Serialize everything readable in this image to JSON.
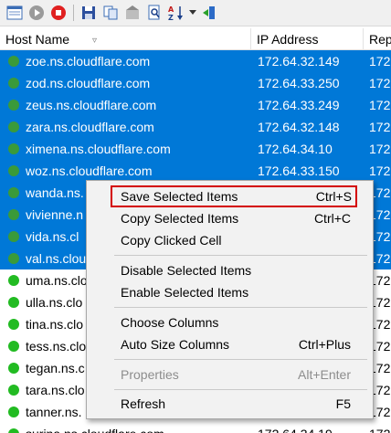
{
  "columns": {
    "host": "Host Name",
    "ip": "IP Address",
    "rep": "Rep"
  },
  "rows": [
    {
      "host": "zoe.ns.cloudflare.com",
      "ip": "172.64.32.149",
      "rep": "172"
    },
    {
      "host": "zod.ns.cloudflare.com",
      "ip": "172.64.33.250",
      "rep": "172"
    },
    {
      "host": "zeus.ns.cloudflare.com",
      "ip": "172.64.33.249",
      "rep": "172"
    },
    {
      "host": "zara.ns.cloudflare.com",
      "ip": "172.64.32.148",
      "rep": "172"
    },
    {
      "host": "ximena.ns.cloudflare.com",
      "ip": "172.64.34.10",
      "rep": "172"
    },
    {
      "host": "woz.ns.cloudflare.com",
      "ip": "172.64.33.150",
      "rep": "172"
    },
    {
      "host": "wanda.ns.",
      "ip": "",
      "rep": "172"
    },
    {
      "host": "vivienne.n",
      "ip": "",
      "rep": "172"
    },
    {
      "host": "vida.ns.cl",
      "ip": "",
      "rep": "172"
    },
    {
      "host": "val.ns.clou",
      "ip": "",
      "rep": "172"
    },
    {
      "host": "uma.ns.clo",
      "ip": "",
      "rep": "172"
    },
    {
      "host": "ulla.ns.clo",
      "ip": "",
      "rep": "172"
    },
    {
      "host": "tina.ns.clo",
      "ip": "",
      "rep": "172"
    },
    {
      "host": "tess.ns.clo",
      "ip": "",
      "rep": "172"
    },
    {
      "host": "tegan.ns.c",
      "ip": "",
      "rep": "172"
    },
    {
      "host": "tara.ns.clo",
      "ip": "",
      "rep": "172"
    },
    {
      "host": "tanner.ns.",
      "ip": "",
      "rep": "172"
    },
    {
      "host": "surina.ns.cloudflare.com",
      "ip": "172.64.34.19",
      "rep": "172"
    }
  ],
  "menu": {
    "save": {
      "label": "Save Selected Items",
      "shortcut": "Ctrl+S"
    },
    "copy_selected": {
      "label": "Copy Selected Items",
      "shortcut": "Ctrl+C"
    },
    "copy_cell": {
      "label": "Copy Clicked Cell",
      "shortcut": ""
    },
    "disable": {
      "label": "Disable Selected Items",
      "shortcut": ""
    },
    "enable": {
      "label": "Enable Selected Items",
      "shortcut": ""
    },
    "choose_columns": {
      "label": "Choose Columns",
      "shortcut": ""
    },
    "auto_size": {
      "label": "Auto Size Columns",
      "shortcut": "Ctrl+Plus"
    },
    "properties": {
      "label": "Properties",
      "shortcut": "Alt+Enter"
    },
    "refresh": {
      "label": "Refresh",
      "shortcut": "F5"
    }
  },
  "colors": {
    "selection": "#0078d7",
    "highlight_border": "#d40000",
    "status_green": "#22bb22"
  }
}
